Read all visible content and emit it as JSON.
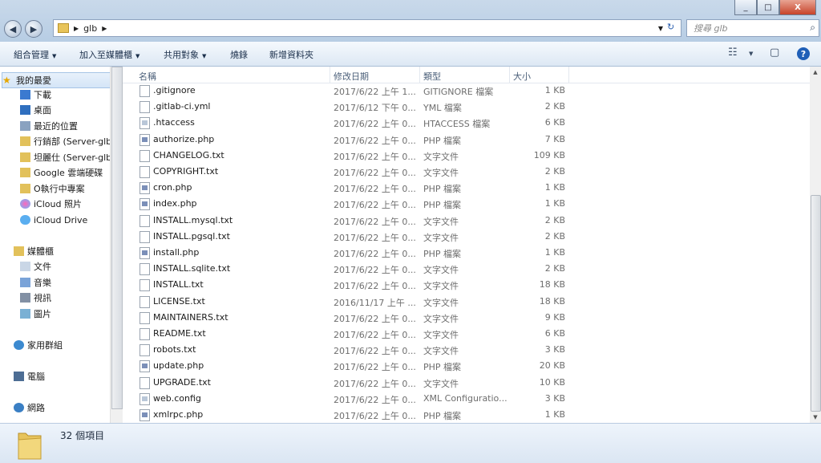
{
  "window": {
    "minimize": "_",
    "maximize": "□",
    "close": "X"
  },
  "address": {
    "crumb": "glb",
    "refresh_icon": "refresh-icon"
  },
  "search": {
    "placeholder": "搜尋 glb"
  },
  "toolbar": {
    "organize": "組合管理",
    "include_library": "加入至媒體櫃",
    "share": "共用對象",
    "burn": "燒錄",
    "new_folder": "新增資料夾"
  },
  "nav": {
    "favorites": "我的最愛",
    "download": "下載",
    "desktop": "桌面",
    "recent": "最近的位置",
    "sales": "行銷部 (Server-glb",
    "tanli": "坦麗仕 (Server-glb",
    "gdrive": "Google 雲端硬碟",
    "oproject": "O執行中專案",
    "icloud_photos": "iCloud 照片",
    "icloud_drive": "iCloud Drive",
    "libraries": "媒體櫃",
    "documents": "文件",
    "music": "音樂",
    "videos": "視訊",
    "pictures": "圖片",
    "homegroup": "家用群組",
    "computer": "電腦",
    "network": "網路"
  },
  "columns": {
    "name": "名稱",
    "date": "修改日期",
    "type": "類型",
    "size": "大小"
  },
  "files": [
    {
      "name": ".gitignore",
      "date": "2017/6/22 上午 1...",
      "type": "GITIGNORE 檔案",
      "size": "1 KB",
      "icon": "file"
    },
    {
      "name": ".gitlab-ci.yml",
      "date": "2017/6/12 下午 0...",
      "type": "YML 檔案",
      "size": "2 KB",
      "icon": "file"
    },
    {
      "name": ".htaccess",
      "date": "2017/6/22 上午 0...",
      "type": "HTACCESS 檔案",
      "size": "6 KB",
      "icon": "cfg"
    },
    {
      "name": "authorize.php",
      "date": "2017/6/22 上午 0...",
      "type": "PHP 檔案",
      "size": "7 KB",
      "icon": "php"
    },
    {
      "name": "CHANGELOG.txt",
      "date": "2017/6/22 上午 0...",
      "type": "文字文件",
      "size": "109 KB",
      "icon": "file"
    },
    {
      "name": "COPYRIGHT.txt",
      "date": "2017/6/22 上午 0...",
      "type": "文字文件",
      "size": "2 KB",
      "icon": "file"
    },
    {
      "name": "cron.php",
      "date": "2017/6/22 上午 0...",
      "type": "PHP 檔案",
      "size": "1 KB",
      "icon": "php"
    },
    {
      "name": "index.php",
      "date": "2017/6/22 上午 0...",
      "type": "PHP 檔案",
      "size": "1 KB",
      "icon": "php"
    },
    {
      "name": "INSTALL.mysql.txt",
      "date": "2017/6/22 上午 0...",
      "type": "文字文件",
      "size": "2 KB",
      "icon": "file"
    },
    {
      "name": "INSTALL.pgsql.txt",
      "date": "2017/6/22 上午 0...",
      "type": "文字文件",
      "size": "2 KB",
      "icon": "file"
    },
    {
      "name": "install.php",
      "date": "2017/6/22 上午 0...",
      "type": "PHP 檔案",
      "size": "1 KB",
      "icon": "php"
    },
    {
      "name": "INSTALL.sqlite.txt",
      "date": "2017/6/22 上午 0...",
      "type": "文字文件",
      "size": "2 KB",
      "icon": "file"
    },
    {
      "name": "INSTALL.txt",
      "date": "2017/6/22 上午 0...",
      "type": "文字文件",
      "size": "18 KB",
      "icon": "file"
    },
    {
      "name": "LICENSE.txt",
      "date": "2016/11/17 上午 ...",
      "type": "文字文件",
      "size": "18 KB",
      "icon": "file"
    },
    {
      "name": "MAINTAINERS.txt",
      "date": "2017/6/22 上午 0...",
      "type": "文字文件",
      "size": "9 KB",
      "icon": "file"
    },
    {
      "name": "README.txt",
      "date": "2017/6/22 上午 0...",
      "type": "文字文件",
      "size": "6 KB",
      "icon": "file"
    },
    {
      "name": "robots.txt",
      "date": "2017/6/22 上午 0...",
      "type": "文字文件",
      "size": "3 KB",
      "icon": "file"
    },
    {
      "name": "update.php",
      "date": "2017/6/22 上午 0...",
      "type": "PHP 檔案",
      "size": "20 KB",
      "icon": "php"
    },
    {
      "name": "UPGRADE.txt",
      "date": "2017/6/22 上午 0...",
      "type": "文字文件",
      "size": "10 KB",
      "icon": "file"
    },
    {
      "name": "web.config",
      "date": "2017/6/22 上午 0...",
      "type": "XML Configuratio...",
      "size": "3 KB",
      "icon": "cfg"
    },
    {
      "name": "xmlrpc.php",
      "date": "2017/6/22 上午 0...",
      "type": "PHP 檔案",
      "size": "1 KB",
      "icon": "php"
    }
  ],
  "status": {
    "item_count": "32 個項目"
  }
}
